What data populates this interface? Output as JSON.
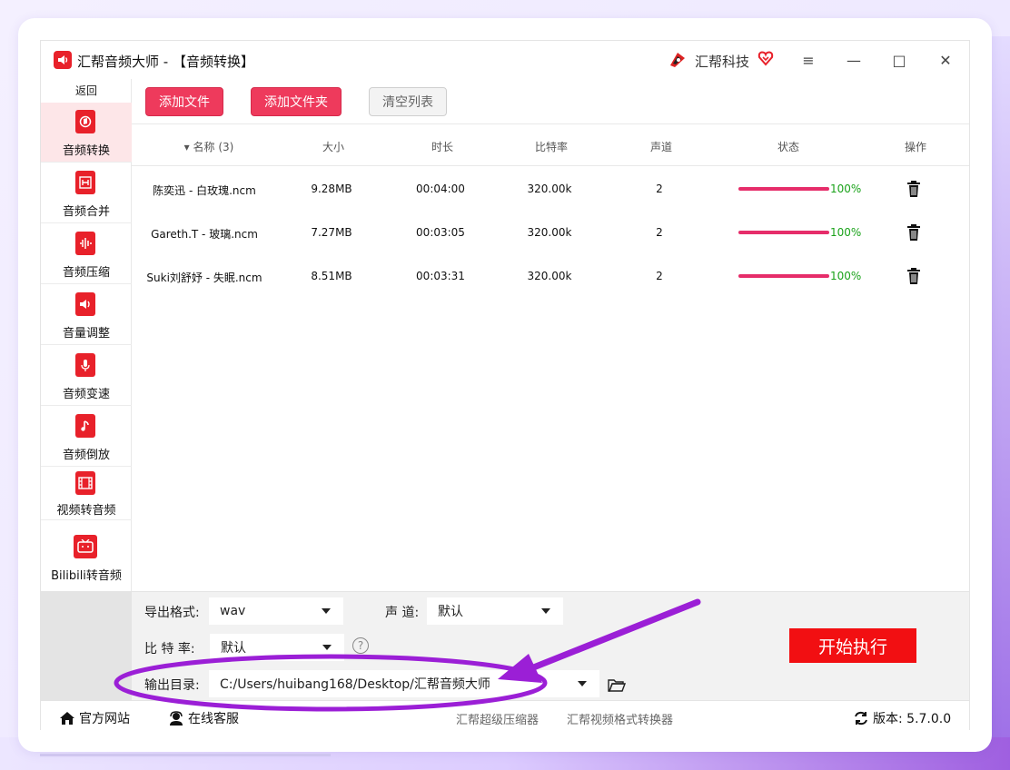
{
  "colors": {
    "accent": "#ee3a5c",
    "brand_red": "#e8212a",
    "start": "#f20f12",
    "progress": "#e62d6a",
    "success": "#1aa21a",
    "annotation": "#9b1fd6"
  },
  "window": {
    "title": "汇帮音频大师  - 【音频转换】",
    "brand": "汇帮科技",
    "controls": {
      "menu": "≡",
      "minimize": "—",
      "maximize": "□",
      "close": "✕"
    }
  },
  "sidebar": {
    "back": "返回",
    "items": [
      {
        "label": "音频转换",
        "icon": "audio-convert-icon"
      },
      {
        "label": "音频合并",
        "icon": "audio-merge-icon"
      },
      {
        "label": "音频压缩",
        "icon": "audio-compress-icon"
      },
      {
        "label": "音量调整",
        "icon": "volume-icon"
      },
      {
        "label": "音频变速",
        "icon": "microphone-icon"
      },
      {
        "label": "音频倒放",
        "icon": "music-note-icon"
      },
      {
        "label": "视频转音频",
        "icon": "film-icon"
      },
      {
        "label": "Bilibili转音频",
        "icon": "tv-icon"
      }
    ]
  },
  "toolbar": {
    "add_file": "添加文件",
    "add_folder": "添加文件夹",
    "clear_list": "清空列表"
  },
  "table": {
    "headers": {
      "name": "▾ 名称 (3)",
      "size": "大小",
      "duration": "时长",
      "bitrate": "比特率",
      "channels": "声道",
      "status": "状态",
      "action": "操作"
    },
    "rows": [
      {
        "name": "陈奕迅 - 白玫瑰.ncm",
        "size": "9.28MB",
        "duration": "00:04:00",
        "bitrate": "320.00k",
        "channels": "2",
        "progress": "100%"
      },
      {
        "name": "Gareth.T - 玻璃.ncm",
        "size": "7.27MB",
        "duration": "00:03:05",
        "bitrate": "320.00k",
        "channels": "2",
        "progress": "100%"
      },
      {
        "name": "Suki刘舒妤 - 失眠.ncm",
        "size": "8.51MB",
        "duration": "00:03:31",
        "bitrate": "320.00k",
        "channels": "2",
        "progress": "100%"
      }
    ]
  },
  "settings": {
    "format_label": "导出格式:",
    "format_value": "wav",
    "channel_label": "声 道:",
    "channel_value": "默认",
    "bitrate_label": "比 特 率:",
    "bitrate_value": "默认",
    "help": "?",
    "output_label": "输出目录:",
    "output_value": "C:/Users/huibang168/Desktop/汇帮音频大师",
    "start": "开始执行"
  },
  "footer": {
    "website": "官方网站",
    "support": "在线客服",
    "link1": "汇帮超级压缩器",
    "link2": "汇帮视频格式转换器",
    "version": "版本:  5.7.0.0"
  }
}
